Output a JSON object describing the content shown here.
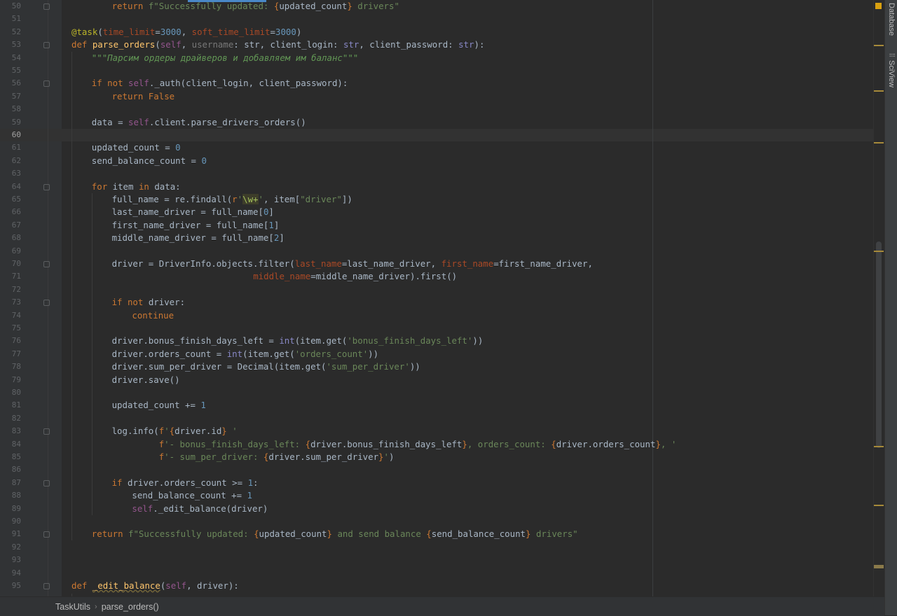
{
  "tool_windows": [
    {
      "label": "Database",
      "icon": "database-icon"
    },
    {
      "label": "SciView",
      "icon": "sciview-icon"
    }
  ],
  "breadcrumb": {
    "items": [
      "TaskUtils",
      "parse_orders()"
    ],
    "separator": "›"
  },
  "editor": {
    "current_line": 60,
    "lines": [
      {
        "n": 50,
        "i": 2,
        "s": [
          [
            "kw",
            "return "
          ],
          [
            "str",
            "f\"Successfully updated: "
          ],
          [
            "kw",
            "{"
          ],
          [
            "",
            "updated_count"
          ],
          [
            "kw",
            "}"
          ],
          [
            "str",
            " drivers\""
          ]
        ]
      },
      {
        "n": 51,
        "i": 0,
        "s": []
      },
      {
        "n": 52,
        "i": 0,
        "s": [
          [
            "deco",
            "@task"
          ],
          [
            "",
            "("
          ],
          [
            "param",
            "time_limit"
          ],
          [
            "",
            "="
          ],
          [
            "num",
            "3000"
          ],
          [
            "",
            ", "
          ],
          [
            "param",
            "soft_time_limit"
          ],
          [
            "",
            "="
          ],
          [
            "num",
            "3000"
          ],
          [
            "",
            ")"
          ]
        ]
      },
      {
        "n": 53,
        "i": 0,
        "s": [
          [
            "kw",
            "def "
          ],
          [
            "fn",
            "parse_orders"
          ],
          [
            "",
            "("
          ],
          [
            "self",
            "self"
          ],
          [
            "",
            ", "
          ],
          [
            "hint",
            "username"
          ],
          [
            "",
            ": str, client_login: "
          ],
          [
            "bi",
            "str"
          ],
          [
            "",
            ", client_password: "
          ],
          [
            "bi",
            "str"
          ],
          [
            "",
            "):"
          ]
        ]
      },
      {
        "n": 54,
        "i": 1,
        "s": [
          [
            "docstr",
            "\"\"\"Парсим ордеры драйверов и добавляем им баланс\"\"\""
          ]
        ]
      },
      {
        "n": 55,
        "i": 0,
        "s": []
      },
      {
        "n": 56,
        "i": 1,
        "s": [
          [
            "kw",
            "if not "
          ],
          [
            "self",
            "self"
          ],
          [
            "",
            "._auth(client_login, client_password):"
          ]
        ]
      },
      {
        "n": 57,
        "i": 2,
        "s": [
          [
            "kw",
            "return False"
          ]
        ]
      },
      {
        "n": 58,
        "i": 0,
        "s": []
      },
      {
        "n": 59,
        "i": 1,
        "s": [
          [
            "",
            "data = "
          ],
          [
            "self",
            "self"
          ],
          [
            "",
            ".client.parse_drivers_orders()"
          ]
        ]
      },
      {
        "n": 60,
        "i": 0,
        "s": []
      },
      {
        "n": 61,
        "i": 1,
        "s": [
          [
            "",
            "updated_count = "
          ],
          [
            "num",
            "0"
          ]
        ]
      },
      {
        "n": 62,
        "i": 1,
        "s": [
          [
            "",
            "send_balance_count = "
          ],
          [
            "num",
            "0"
          ]
        ]
      },
      {
        "n": 63,
        "i": 0,
        "s": []
      },
      {
        "n": 64,
        "i": 1,
        "s": [
          [
            "kw",
            "for "
          ],
          [
            "",
            "item "
          ],
          [
            "kw",
            "in "
          ],
          [
            "",
            "data:"
          ]
        ]
      },
      {
        "n": 65,
        "i": 2,
        "s": [
          [
            "",
            "full_name = re.findall("
          ],
          [
            "kw",
            "r"
          ],
          [
            "str",
            "'"
          ],
          [
            "regex",
            "\\w+"
          ],
          [
            "str",
            "'"
          ],
          [
            "",
            ", item["
          ],
          [
            "str",
            "\"driver\""
          ],
          [
            "",
            "])"
          ]
        ]
      },
      {
        "n": 66,
        "i": 2,
        "s": [
          [
            "",
            "last_name_driver = full_name["
          ],
          [
            "num",
            "0"
          ],
          [
            "",
            "]"
          ]
        ]
      },
      {
        "n": 67,
        "i": 2,
        "s": [
          [
            "",
            "first_name_driver = full_name["
          ],
          [
            "num",
            "1"
          ],
          [
            "",
            "]"
          ]
        ]
      },
      {
        "n": 68,
        "i": 2,
        "s": [
          [
            "",
            "middle_name_driver = full_name["
          ],
          [
            "num",
            "2"
          ],
          [
            "",
            "]"
          ]
        ]
      },
      {
        "n": 69,
        "i": 0,
        "s": []
      },
      {
        "n": 70,
        "i": 2,
        "s": [
          [
            "",
            "driver = DriverInfo.objects.filter("
          ],
          [
            "param",
            "last_name"
          ],
          [
            "",
            "=last_name_driver, "
          ],
          [
            "param",
            "first_name"
          ],
          [
            "",
            "=first_name_driver,"
          ]
        ]
      },
      {
        "n": 71,
        "i": 9,
        "s": [
          [
            "param",
            "middle_name"
          ],
          [
            "",
            "=middle_name_driver).first()"
          ]
        ]
      },
      {
        "n": 72,
        "i": 0,
        "s": []
      },
      {
        "n": 73,
        "i": 2,
        "s": [
          [
            "kw",
            "if not "
          ],
          [
            "",
            "driver:"
          ]
        ]
      },
      {
        "n": 74,
        "i": 3,
        "s": [
          [
            "kw",
            "continue"
          ]
        ]
      },
      {
        "n": 75,
        "i": 0,
        "s": []
      },
      {
        "n": 76,
        "i": 2,
        "s": [
          [
            "",
            "driver.bonus_finish_days_left = "
          ],
          [
            "bi",
            "int"
          ],
          [
            "",
            "(item.get("
          ],
          [
            "str",
            "'bonus_finish_days_left'"
          ],
          [
            "",
            "))"
          ]
        ]
      },
      {
        "n": 77,
        "i": 2,
        "s": [
          [
            "",
            "driver.orders_count = "
          ],
          [
            "bi",
            "int"
          ],
          [
            "",
            "(item.get("
          ],
          [
            "str",
            "'orders_count'"
          ],
          [
            "",
            "))"
          ]
        ]
      },
      {
        "n": 78,
        "i": 2,
        "s": [
          [
            "",
            "driver.sum_per_driver = Decimal(item.get("
          ],
          [
            "str",
            "'sum_per_driver'"
          ],
          [
            "",
            "))"
          ]
        ]
      },
      {
        "n": 79,
        "i": 2,
        "s": [
          [
            "",
            "driver.save()"
          ]
        ]
      },
      {
        "n": 80,
        "i": 0,
        "s": []
      },
      {
        "n": 81,
        "i": 2,
        "s": [
          [
            "",
            "updated_count += "
          ],
          [
            "num",
            "1"
          ]
        ]
      },
      {
        "n": 82,
        "i": 0,
        "s": []
      },
      {
        "n": 83,
        "i": 2,
        "s": [
          [
            "",
            "log.info("
          ],
          [
            "kw",
            "f"
          ],
          [
            "str",
            "'"
          ],
          [
            "kw",
            "{"
          ],
          [
            "",
            "driver.id"
          ],
          [
            "kw",
            "}"
          ],
          [
            "str",
            " '"
          ]
        ]
      },
      {
        "n": 84,
        "i": 4.33,
        "s": [
          [
            "kw",
            "f"
          ],
          [
            "str",
            "'- bonus_finish_days_left: "
          ],
          [
            "kw",
            "{"
          ],
          [
            "",
            "driver.bonus_finish_days_left"
          ],
          [
            "kw",
            "}"
          ],
          [
            "str",
            ", orders_count: "
          ],
          [
            "kw",
            "{"
          ],
          [
            "",
            "driver.orders_count"
          ],
          [
            "kw",
            "}"
          ],
          [
            "str",
            ", '"
          ]
        ]
      },
      {
        "n": 85,
        "i": 4.33,
        "s": [
          [
            "kw",
            "f"
          ],
          [
            "str",
            "'- sum_per_driver: "
          ],
          [
            "kw",
            "{"
          ],
          [
            "",
            "driver.sum_per_driver"
          ],
          [
            "kw",
            "}"
          ],
          [
            "str",
            "'"
          ],
          [
            "",
            ")"
          ]
        ]
      },
      {
        "n": 86,
        "i": 0,
        "s": []
      },
      {
        "n": 87,
        "i": 2,
        "s": [
          [
            "kw",
            "if "
          ],
          [
            "",
            "driver.orders_count >= "
          ],
          [
            "num",
            "1"
          ],
          [
            "",
            ":"
          ]
        ]
      },
      {
        "n": 88,
        "i": 3,
        "s": [
          [
            "",
            "send_balance_count += "
          ],
          [
            "num",
            "1"
          ]
        ]
      },
      {
        "n": 89,
        "i": 3,
        "s": [
          [
            "self",
            "self"
          ],
          [
            "",
            "._edit_balance(driver)"
          ]
        ]
      },
      {
        "n": 90,
        "i": 0,
        "s": []
      },
      {
        "n": 91,
        "i": 1,
        "s": [
          [
            "kw",
            "return "
          ],
          [
            "str",
            "f\"Successfully updated: "
          ],
          [
            "kw",
            "{"
          ],
          [
            "",
            "updated_count"
          ],
          [
            "kw",
            "}"
          ],
          [
            "str",
            " and send balance "
          ],
          [
            "kw",
            "{"
          ],
          [
            "",
            "send_balance_count"
          ],
          [
            "kw",
            "}"
          ],
          [
            "str",
            " drivers\""
          ]
        ]
      },
      {
        "n": 92,
        "i": 0,
        "s": []
      },
      {
        "n": 93,
        "i": 0,
        "s": []
      },
      {
        "n": 94,
        "i": 0,
        "s": []
      },
      {
        "n": 95,
        "i": 0,
        "s": [
          [
            "kw",
            "def "
          ],
          [
            "fn warn",
            "_edit_balance"
          ],
          [
            "",
            "("
          ],
          [
            "self",
            "self"
          ],
          [
            "",
            ", driver):"
          ]
        ]
      }
    ]
  }
}
